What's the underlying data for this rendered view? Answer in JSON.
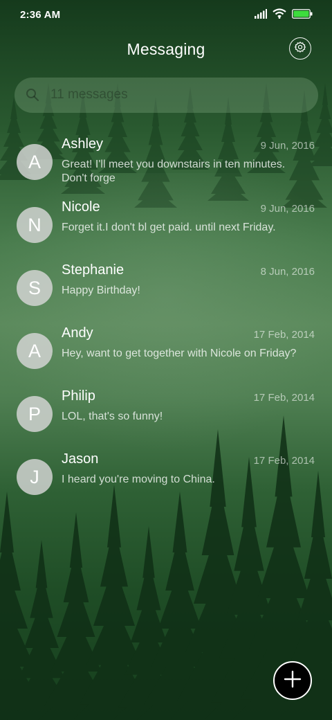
{
  "status_bar": {
    "time": "2:36 AM",
    "icons": [
      "signal-icon",
      "wifi-icon",
      "battery-icon"
    ],
    "battery_color": "#3ddc3d"
  },
  "header": {
    "title": "Messaging",
    "settings_icon": "gear-icon"
  },
  "search": {
    "placeholder": "11 messages",
    "icon": "search-icon"
  },
  "conversations": [
    {
      "initial": "A",
      "name": "Ashley",
      "date": "9 Jun, 2016",
      "preview": "Great! I'll meet you downstairs in ten minutes. Don't forge"
    },
    {
      "initial": "N",
      "name": "Nicole",
      "date": "9 Jun, 2016",
      "preview": "Forget it.I don't bl get paid. until next Friday."
    },
    {
      "initial": "S",
      "name": "Stephanie",
      "date": "8 Jun, 2016",
      "preview": "Happy Birthday!"
    },
    {
      "initial": "A",
      "name": "Andy",
      "date": "17 Feb, 2014",
      "preview": "Hey, want to get together with Nicole on Friday?"
    },
    {
      "initial": "P",
      "name": "Philip",
      "date": "17 Feb, 2014",
      "preview": "LOL, that's so funny!"
    },
    {
      "initial": "J",
      "name": "Jason",
      "date": "17 Feb, 2014",
      "preview": "I heard you're moving to China."
    }
  ],
  "fab": {
    "icon": "plus-icon"
  },
  "colors": {
    "background_forest": "#2f6135",
    "avatar": "#d7d7d7",
    "fab": "#000000"
  }
}
